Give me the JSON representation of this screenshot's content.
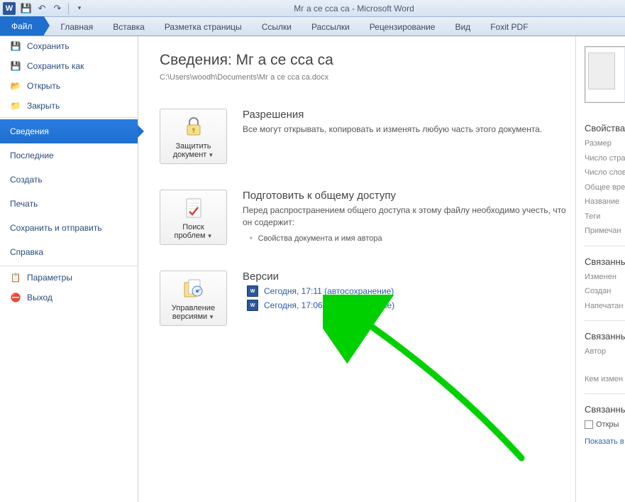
{
  "title": "Mг а се  сса са  -  Microsoft Word",
  "ribbon": {
    "file": "Файл",
    "tabs": [
      "Главная",
      "Вставка",
      "Разметка страницы",
      "Ссылки",
      "Рассылки",
      "Рецензирование",
      "Вид",
      "Foxit PDF"
    ]
  },
  "sidebar": {
    "save": "Сохранить",
    "save_as": "Сохранить как",
    "open": "Открыть",
    "close": "Закрыть",
    "info": "Сведения",
    "recent": "Последние",
    "create": "Создать",
    "print": "Печать",
    "send": "Сохранить и отправить",
    "help": "Справка",
    "options": "Параметры",
    "exit": "Выход"
  },
  "info": {
    "heading": "Сведения: Mг а се  сса са",
    "path": "C:\\Users\\woodh\\Documents\\Mг а се  сса са.docx",
    "perm_title": "Разрешения",
    "perm_desc": "Все могут открывать, копировать и изменять любую часть этого документа.",
    "protect_btn": "Защитить документ",
    "prep_title": "Подготовить к общему доступу",
    "prep_desc": "Перед распространением общего доступа к этому файлу необходимо учесть, что он содержит:",
    "prep_bullet": "Свойства документа и имя автора",
    "inspect_btn": "Поиск проблем",
    "ver_title": "Версии",
    "versions": [
      "Сегодня, 17:11 (автосохранение)",
      "Сегодня, 17:06 (автосохранение)"
    ],
    "manage_btn": "Управление версиями"
  },
  "props": {
    "head": "Свойства",
    "size": "Размер",
    "pages": "Число стра",
    "words": "Число слов",
    "edit_time": "Общее вре",
    "name": "Название",
    "tags": "Теги",
    "comments": "Примечан",
    "related_head": "Связанные",
    "changed": "Изменен",
    "created": "Создан",
    "printed": "Напечатан",
    "related2_head": "Связанные",
    "author": "Автор",
    "by": "Кем измен",
    "related3_head": "Связанные",
    "open_loc": "Откры",
    "show_all": "Показать в"
  }
}
